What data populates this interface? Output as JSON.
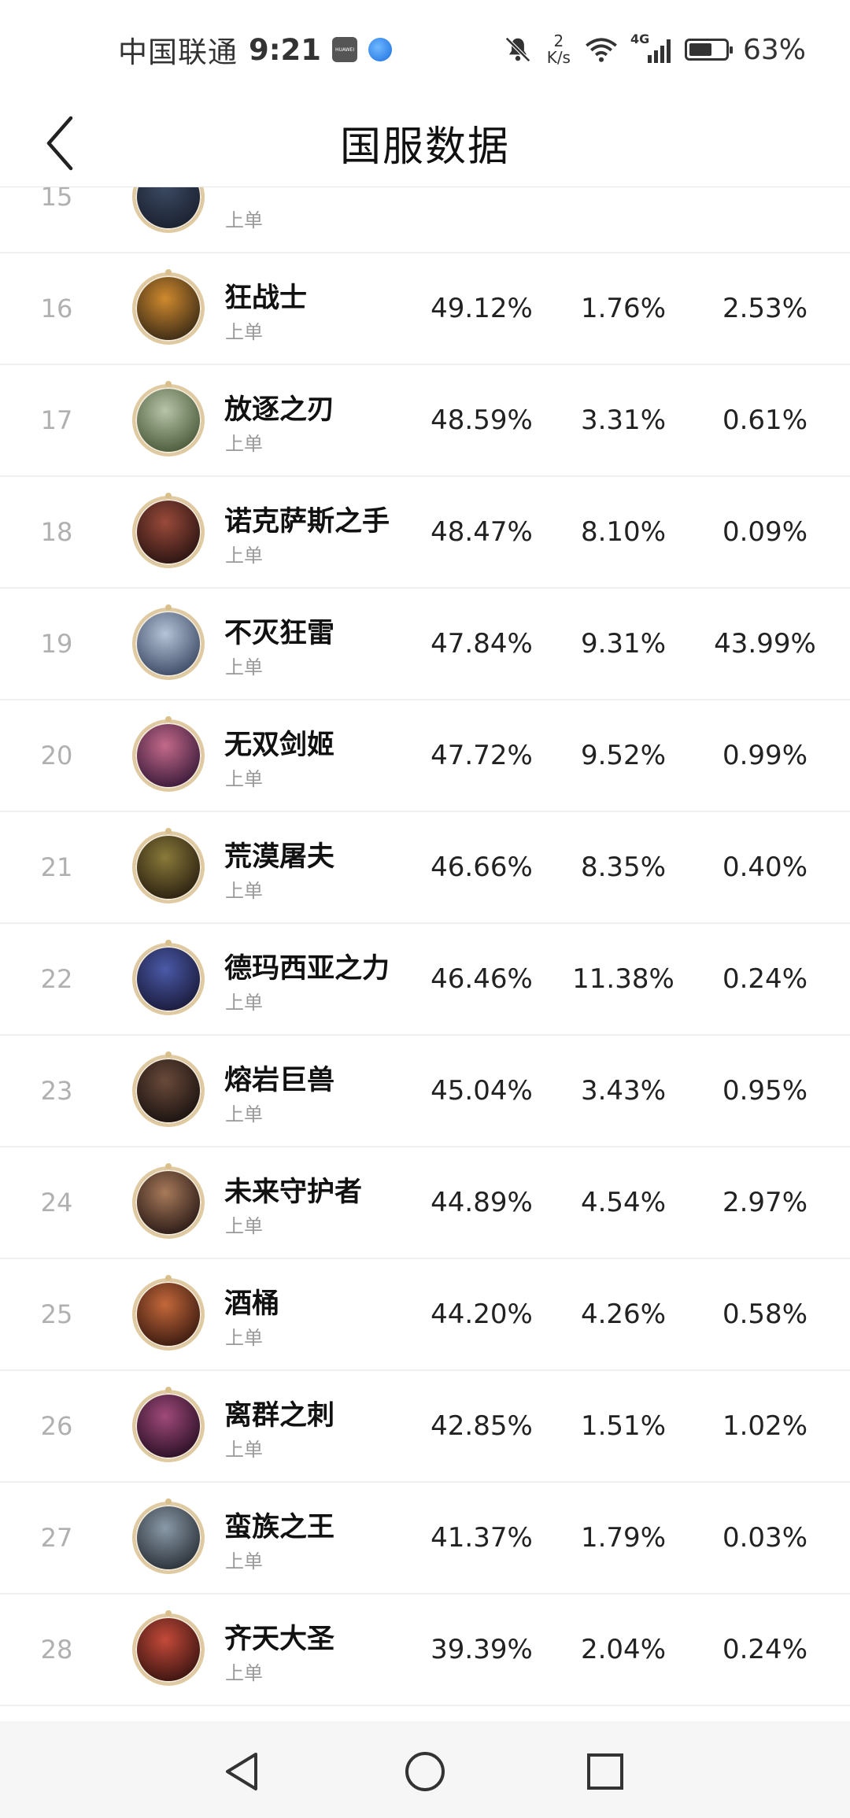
{
  "status_bar": {
    "carrier": "中国联通",
    "time": "9:21",
    "net_speed_value": "2",
    "net_speed_unit": "K/s",
    "signal_label": "4G",
    "battery_percent": "63%",
    "battery_level": 0.63
  },
  "header": {
    "title": "国服数据"
  },
  "rows": [
    {
      "rank": "15",
      "name": "",
      "position": "上单",
      "win_rate": "",
      "pick_rate": "",
      "ban_rate": "",
      "avatar_colors": [
        "#3b4a63",
        "#1b2130"
      ]
    },
    {
      "rank": "16",
      "name": "狂战士",
      "position": "上单",
      "win_rate": "49.12%",
      "pick_rate": "1.76%",
      "ban_rate": "2.53%",
      "avatar_colors": [
        "#d08a2e",
        "#3a2a16"
      ]
    },
    {
      "rank": "17",
      "name": "放逐之刃",
      "position": "上单",
      "win_rate": "48.59%",
      "pick_rate": "3.31%",
      "ban_rate": "0.61%",
      "avatar_colors": [
        "#b8c4a8",
        "#4a5a3a"
      ]
    },
    {
      "rank": "18",
      "name": "诺克萨斯之手",
      "position": "上单",
      "win_rate": "48.47%",
      "pick_rate": "8.10%",
      "ban_rate": "0.09%",
      "avatar_colors": [
        "#9a4a3a",
        "#2a1412"
      ]
    },
    {
      "rank": "19",
      "name": "不灭狂雷",
      "position": "上单",
      "win_rate": "47.84%",
      "pick_rate": "9.31%",
      "ban_rate": "43.99%",
      "avatar_colors": [
        "#b6c4d8",
        "#3c4a66"
      ]
    },
    {
      "rank": "20",
      "name": "无双剑姬",
      "position": "上单",
      "win_rate": "47.72%",
      "pick_rate": "9.52%",
      "ban_rate": "0.99%",
      "avatar_colors": [
        "#c46a8a",
        "#3a1a3a"
      ]
    },
    {
      "rank": "21",
      "name": "荒漠屠夫",
      "position": "上单",
      "win_rate": "46.66%",
      "pick_rate": "8.35%",
      "ban_rate": "0.40%",
      "avatar_colors": [
        "#8a7a3a",
        "#2a2010"
      ]
    },
    {
      "rank": "22",
      "name": "德玛西亚之力",
      "position": "上单",
      "win_rate": "46.46%",
      "pick_rate": "11.38%",
      "ban_rate": "0.24%",
      "avatar_colors": [
        "#4a5aa8",
        "#1a1a3a"
      ]
    },
    {
      "rank": "23",
      "name": "熔岩巨兽",
      "position": "上单",
      "win_rate": "45.04%",
      "pick_rate": "3.43%",
      "ban_rate": "0.95%",
      "avatar_colors": [
        "#6a4a3a",
        "#1a1210"
      ]
    },
    {
      "rank": "24",
      "name": "未来守护者",
      "position": "上单",
      "win_rate": "44.89%",
      "pick_rate": "4.54%",
      "ban_rate": "2.97%",
      "avatar_colors": [
        "#a87a5a",
        "#2a1a16"
      ]
    },
    {
      "rank": "25",
      "name": "酒桶",
      "position": "上单",
      "win_rate": "44.20%",
      "pick_rate": "4.26%",
      "ban_rate": "0.58%",
      "avatar_colors": [
        "#c4683a",
        "#3a1a10"
      ]
    },
    {
      "rank": "26",
      "name": "离群之刺",
      "position": "上单",
      "win_rate": "42.85%",
      "pick_rate": "1.51%",
      "ban_rate": "1.02%",
      "avatar_colors": [
        "#a04a7a",
        "#2a1026"
      ]
    },
    {
      "rank": "27",
      "name": "蛮族之王",
      "position": "上单",
      "win_rate": "41.37%",
      "pick_rate": "1.79%",
      "ban_rate": "0.03%",
      "avatar_colors": [
        "#8a9aa8",
        "#2a3038"
      ]
    },
    {
      "rank": "28",
      "name": "齐天大圣",
      "position": "上单",
      "win_rate": "39.39%",
      "pick_rate": "2.04%",
      "ban_rate": "0.24%",
      "avatar_colors": [
        "#c44a3a",
        "#3a1410"
      ]
    }
  ],
  "nav_bar": {
    "back_icon": "triangle-back-icon",
    "home_icon": "circle-home-icon",
    "recents_icon": "square-recents-icon"
  }
}
